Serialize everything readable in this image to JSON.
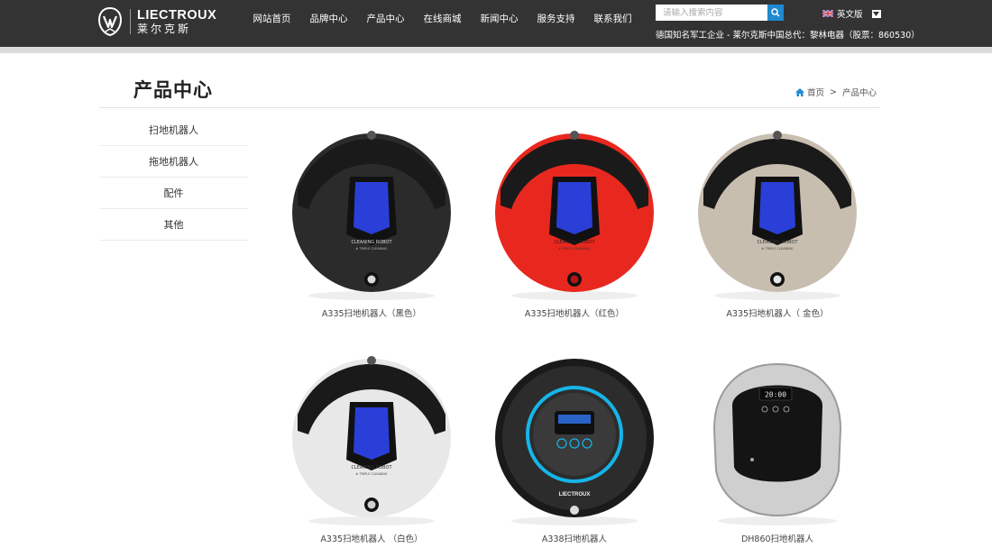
{
  "header": {
    "brand_en": "LIECTROUX",
    "brand_cn": "莱尔克斯",
    "nav": [
      "网站首页",
      "品牌中心",
      "产品中心",
      "在线商城",
      "新闻中心",
      "服务支持",
      "联系我们"
    ],
    "search": {
      "placeholder": "请输入搜索内容"
    },
    "language": "英文版",
    "tagline": "德国知名军工企业 - 莱尔克斯中国总代：黎林电器（股票：860530）"
  },
  "page": {
    "title": "产品中心",
    "breadcrumb": [
      "首页",
      ">",
      "产品中心"
    ]
  },
  "sidebar": {
    "items": [
      "扫地机器人",
      "拖地机器人",
      "配件",
      "其他"
    ]
  },
  "products": [
    {
      "name": "A335扫地机器人（黑色）",
      "color": "#2b2b2b"
    },
    {
      "name": "A335扫地机器人（红色）",
      "color": "#e8281e"
    },
    {
      "name": "A335扫地机器人（ 金色）",
      "color": "#c8beb0"
    },
    {
      "name": "A335扫地机器人 （白色）",
      "color": "#e8e8e8"
    },
    {
      "name": "A338扫地机器人",
      "color": "#1a1a1a"
    },
    {
      "name": "DH860扫地机器人",
      "color": "#d6d6d6"
    }
  ],
  "product_label_text": {
    "robot_model": "CLEANING ROBOT",
    "robot_sub": "⊕ TRIPLE CLEANING",
    "clock": "20:00",
    "a338_logo": "LIECTROUX"
  },
  "colors": {
    "header_bg": "#333333",
    "accent": "#1f8ad1",
    "screen": "#2a3fd8",
    "a338_ring": "#16b5e8"
  }
}
